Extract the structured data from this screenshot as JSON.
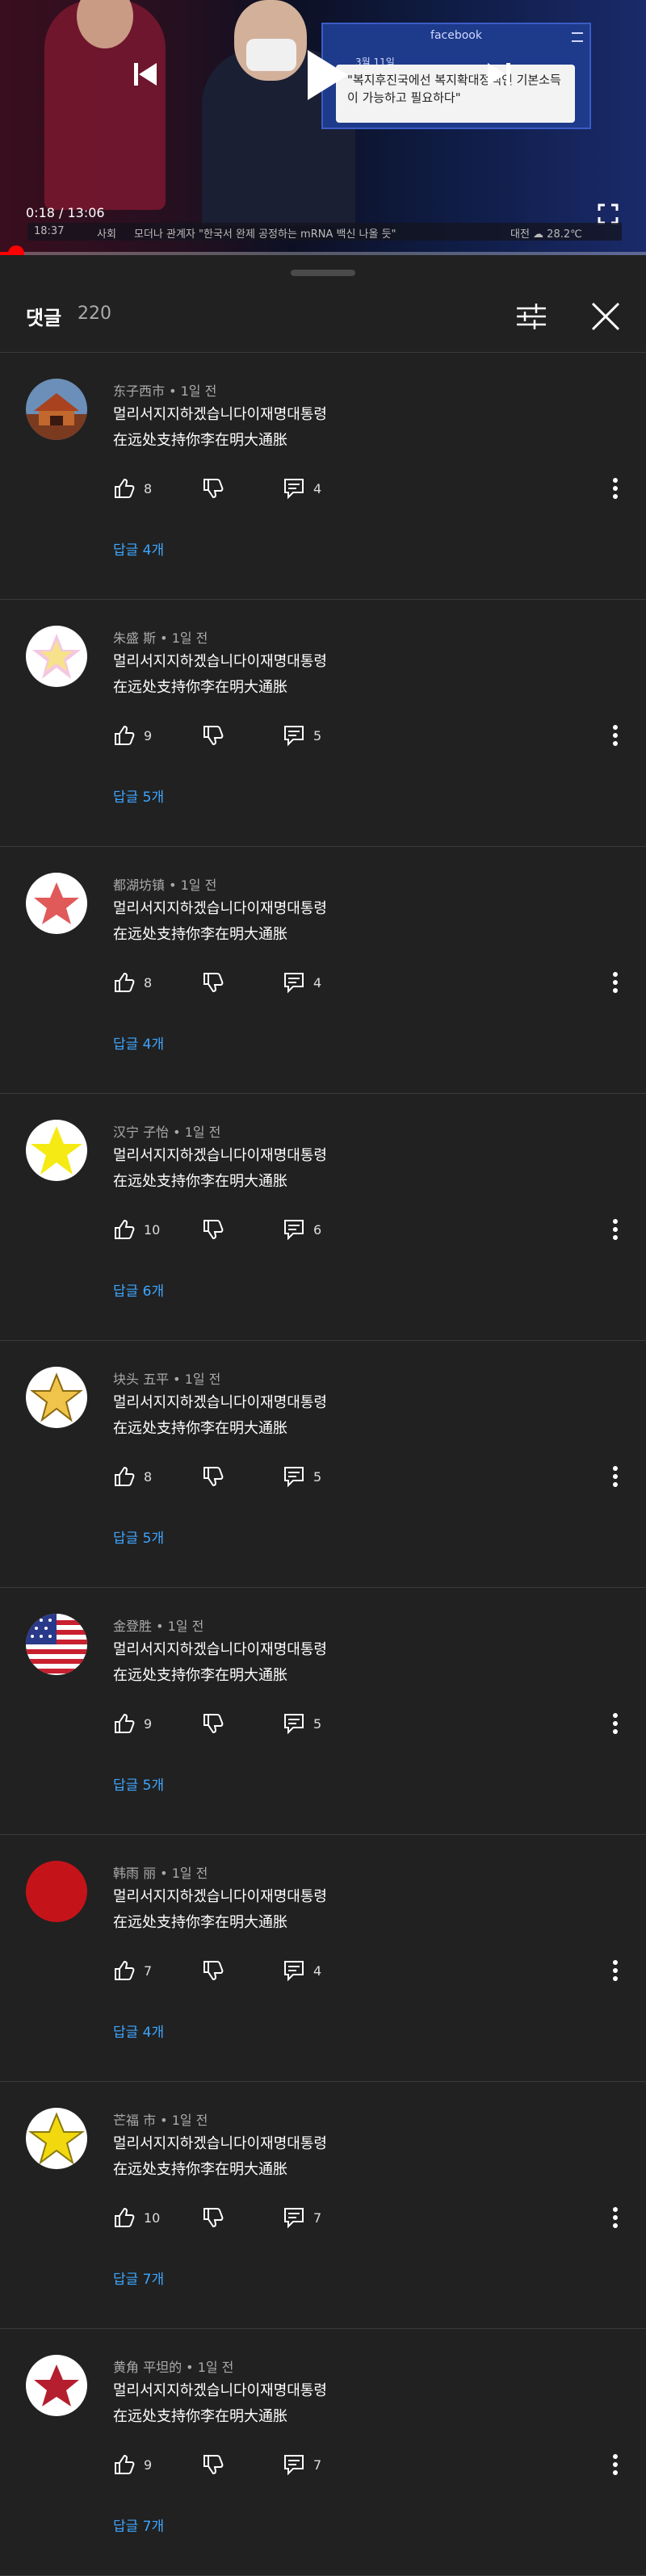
{
  "video": {
    "time": "0:18 / 13:06",
    "facebook_logo": "facebook",
    "facebook_date": "3월 11일",
    "facebook_quote": "\"복지후진국에선 복지확대정책인 기본소득이 가능하고 필요하다\"",
    "ticker_time": "18:37",
    "ticker_category": "사회",
    "ticker_text": "모더나 관계자 \"한국서 완제 공정하는 mRNA 백신 나올 듯\"",
    "ticker_weather": "대전 ☁ 28.2℃",
    "progress_fraction": 0.023
  },
  "header": {
    "title": "댓글",
    "count": "220"
  },
  "comments": [
    {
      "author": "东子西市 • 1일 전",
      "line1": "멀리서지지하겠습니다이재명대통령",
      "line2": "在远处支持你李在明大通胀",
      "likes": "8",
      "replies_count": "4",
      "replies_label": "답글 4개",
      "avatar": "temple-photo"
    },
    {
      "author": "朱盛 斯 • 1일 전",
      "line1": "멀리서지지하겠습니다이재명대통령",
      "line2": "在远处支持你李在明大通胀",
      "likes": "9",
      "replies_count": "5",
      "replies_label": "답글 5개",
      "avatar": "pink-yellow-star"
    },
    {
      "author": "都湖坊镇 • 1일 전",
      "line1": "멀리서지지하겠습니다이재명대통령",
      "line2": "在远处支持你李在明大通胀",
      "likes": "8",
      "replies_count": "4",
      "replies_label": "답글 4개",
      "avatar": "red-star"
    },
    {
      "author": "汉宁 子怡 • 1일 전",
      "line1": "멀리서지지하겠습니다이재명대통령",
      "line2": "在远处支持你李在明大通胀",
      "likes": "10",
      "replies_count": "6",
      "replies_label": "답글 6개",
      "avatar": "yellow-star"
    },
    {
      "author": "块头 五平 • 1일 전",
      "line1": "멀리서지지하겠습니다이재명대통령",
      "line2": "在远处支持你李在明大通胀",
      "likes": "8",
      "replies_count": "5",
      "replies_label": "답글 5개",
      "avatar": "gold-star"
    },
    {
      "author": "金登胜 • 1일 전",
      "line1": "멀리서지지하겠습니다이재명대통령",
      "line2": "在远处支持你李在明大通胀",
      "likes": "9",
      "replies_count": "5",
      "replies_label": "답글 5개",
      "avatar": "us-flag"
    },
    {
      "author": "韩雨 丽 • 1일 전",
      "line1": "멀리서지지하겠습니다이재명대통령",
      "line2": "在远处支持你李在明大通胀",
      "likes": "7",
      "replies_count": "4",
      "replies_label": "답글 4개",
      "avatar": "red-circle"
    },
    {
      "author": "芒福 市 • 1일 전",
      "line1": "멀리서지지하겠습니다이재명대통령",
      "line2": "在远处支持你李在明大通胀",
      "likes": "10",
      "replies_count": "7",
      "replies_label": "답글 7개",
      "avatar": "yellow-star-2"
    },
    {
      "author": "黄角 平坦的 • 1일 전",
      "line1": "멀리서지지하겠습니다이재명대통령",
      "line2": "在远处支持你李在明大通胀",
      "likes": "9",
      "replies_count": "7",
      "replies_label": "답글 7개",
      "avatar": "dark-red-star"
    }
  ],
  "colors": {
    "background": "#212121",
    "reply_link": "#3ea6ff",
    "progress": "#ff0000"
  }
}
